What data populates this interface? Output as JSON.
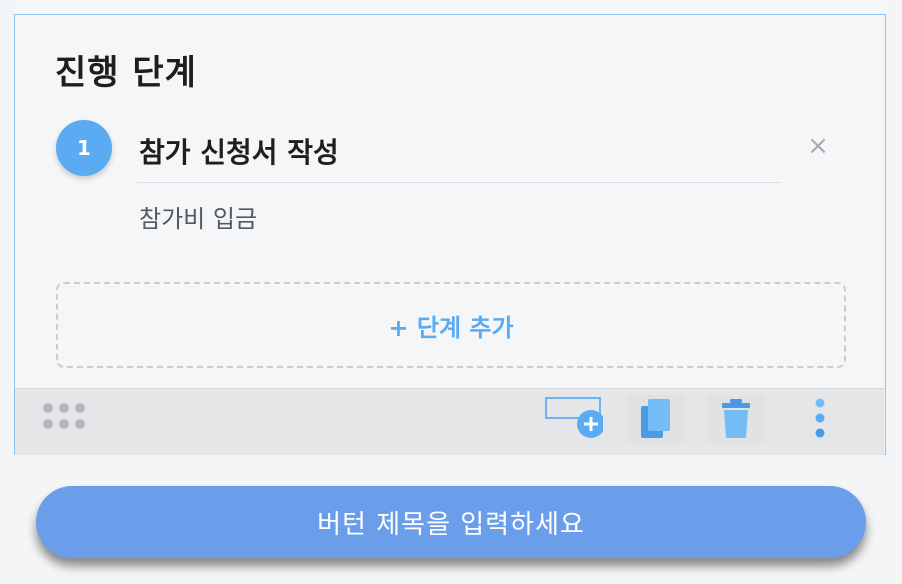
{
  "section": {
    "heading": "진행 단계",
    "steps": [
      {
        "number": "1",
        "title": "참가 신청서 작성"
      }
    ],
    "sub_item": "참가비 입금",
    "add_step_label": "+ 단계 추가"
  },
  "toolbar": {
    "icons": [
      "drag-handle-icon",
      "add-block-icon",
      "copy-icon",
      "trash-icon",
      "more-vertical-icon"
    ]
  },
  "cta": {
    "label": "버턴 제목을 입력하세요"
  },
  "colors": {
    "accent": "#5aabf2",
    "cta_bg": "#6b9eea",
    "border": "#8ec3f1"
  }
}
